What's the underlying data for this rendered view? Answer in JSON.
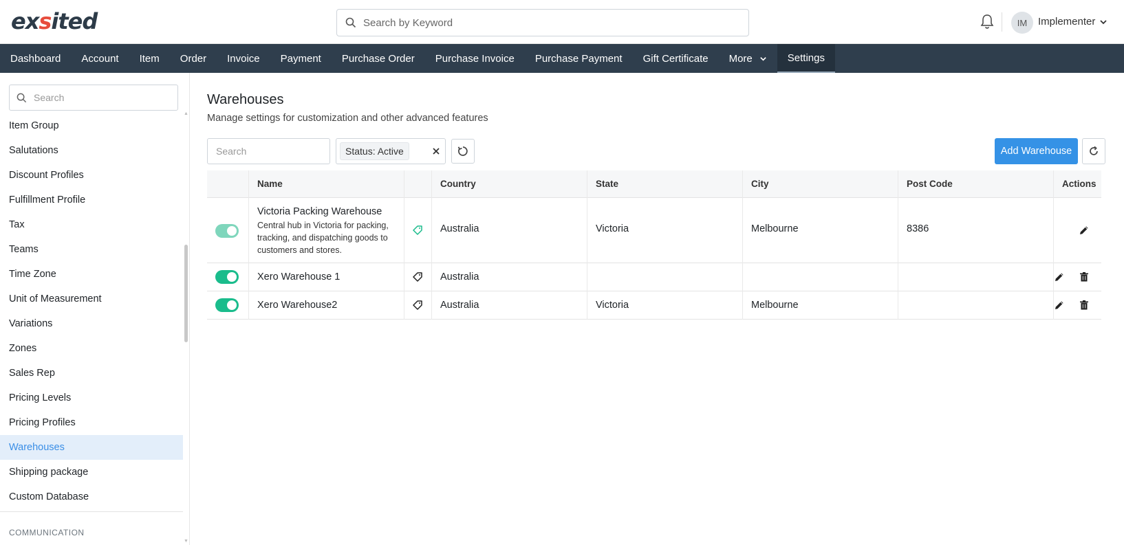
{
  "header": {
    "logo_text": "exsited",
    "search_placeholder": "Search by Keyword",
    "user_initials": "IM",
    "user_name": "Implementer"
  },
  "nav": {
    "items": [
      "Dashboard",
      "Account",
      "Item",
      "Order",
      "Invoice",
      "Payment",
      "Purchase Order",
      "Purchase Invoice",
      "Purchase Payment",
      "Gift Certificate",
      "More",
      "Settings"
    ],
    "active": "Settings"
  },
  "sidebar": {
    "search_placeholder": "Search",
    "items": [
      "Item Group",
      "Salutations",
      "Discount Profiles",
      "Fulfillment Profile",
      "Tax",
      "Teams",
      "Time Zone",
      "Unit of Measurement",
      "Variations",
      "Zones",
      "Sales Rep",
      "Pricing Levels",
      "Pricing Profiles",
      "Warehouses",
      "Shipping package",
      "Custom Database"
    ],
    "active": "Warehouses",
    "section_label": "COMMUNICATION"
  },
  "main": {
    "title": "Warehouses",
    "subtitle": "Manage settings for customization and other advanced features",
    "search_placeholder": "Search",
    "status_filter": "Status: Active",
    "add_button": "Add Warehouse"
  },
  "table": {
    "columns": [
      "Name",
      "Country",
      "State",
      "City",
      "Post Code",
      "Actions"
    ],
    "rows": [
      {
        "name": "Victoria Packing Warehouse",
        "description": "Central hub in Victoria for packing, tracking, and dispatching goods to customers and stores.",
        "country": "Australia",
        "state": "Victoria",
        "city": "Melbourne",
        "postcode": "8386",
        "active": true,
        "default": true
      },
      {
        "name": "Xero Warehouse 1",
        "description": "",
        "country": "Australia",
        "state": "",
        "city": "",
        "postcode": "",
        "active": true,
        "default": false
      },
      {
        "name": "Xero Warehouse2",
        "description": "",
        "country": "Australia",
        "state": "Victoria",
        "city": "Melbourne",
        "postcode": "",
        "active": true,
        "default": false
      }
    ]
  },
  "colors": {
    "nav_bg": "#2f3e4d",
    "primary": "#3592e6",
    "toggle_on": "#1abc8c",
    "sidebar_active_bg": "#e3eefa"
  }
}
